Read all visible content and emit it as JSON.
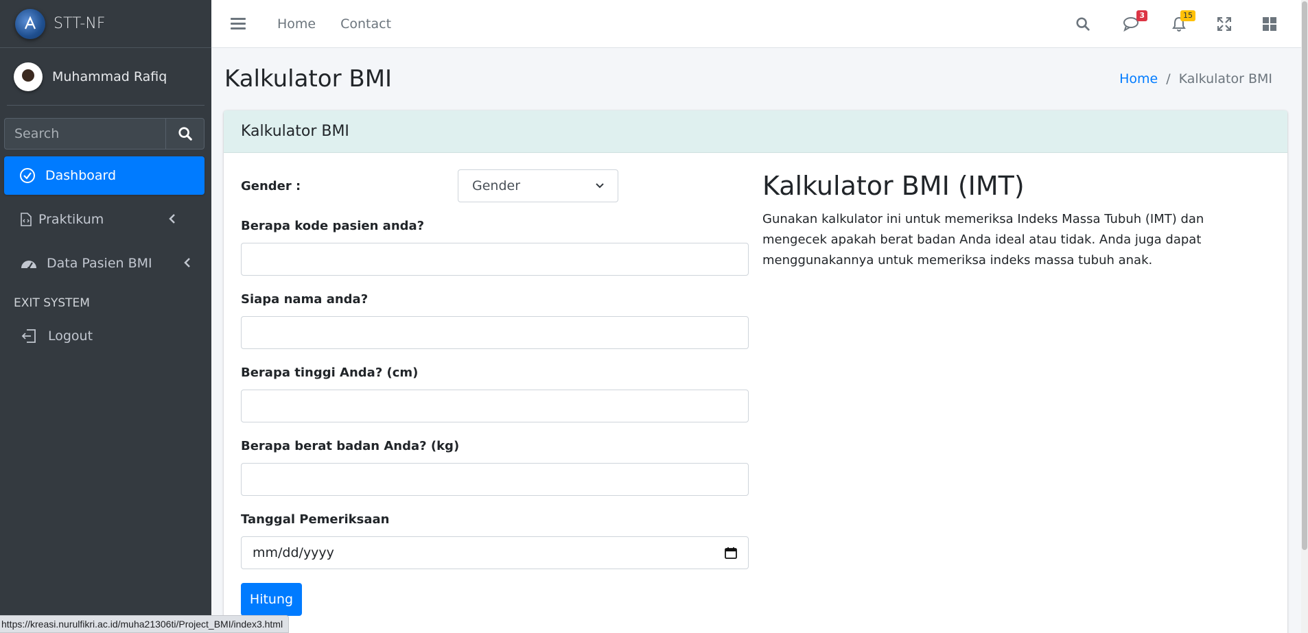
{
  "sidebar": {
    "brand": "STT-NF",
    "user_name": "Muhammad Rafiq",
    "search_placeholder": "Search",
    "nav": [
      {
        "label": "Dashboard",
        "icon": "check-circle-icon",
        "active": true
      },
      {
        "label": "Praktikum",
        "icon": "file-code-icon"
      },
      {
        "label": "Data Pasien BMI",
        "icon": "tachometer-icon"
      }
    ],
    "section_header": "EXIT SYSTEM",
    "logout": "Logout"
  },
  "topbar": {
    "links": [
      "Home",
      "Contact"
    ],
    "messages_badge": "3",
    "notifications_badge": "15"
  },
  "header": {
    "title": "Kalkulator BMI",
    "breadcrumb": {
      "home": "Home",
      "current": "Kalkulator BMI"
    }
  },
  "card": {
    "title": "Kalkulator BMI",
    "form": {
      "gender_label": "Gender :",
      "gender_selected": "Gender",
      "kode_label": "Berapa kode pasien anda?",
      "nama_label": "Siapa nama anda?",
      "tinggi_label": "Berapa tinggi Anda? (cm)",
      "berat_label": "Berapa berat badan Anda? (kg)",
      "tanggal_label": "Tanggal Pemeriksaan",
      "tanggal_placeholder": "mm/dd/yyyy",
      "submit": "Hitung"
    },
    "info": {
      "title": "Kalkulator BMI (IMT)",
      "text": "Gunakan kalkulator ini untuk memeriksa Indeks Massa Tubuh (IMT) dan mengecek apakah berat badan Anda ideal atau tidak. Anda juga dapat menggunakannya untuk memeriksa indeks massa tubuh anak."
    }
  },
  "status_url": "https://kreasi.nurulfikri.ac.id/muha21306ti/Project_BMI/index3.html",
  "colors": {
    "primary": "#007bff",
    "sidebar": "#343a40",
    "card_header": "#dff0ef"
  }
}
